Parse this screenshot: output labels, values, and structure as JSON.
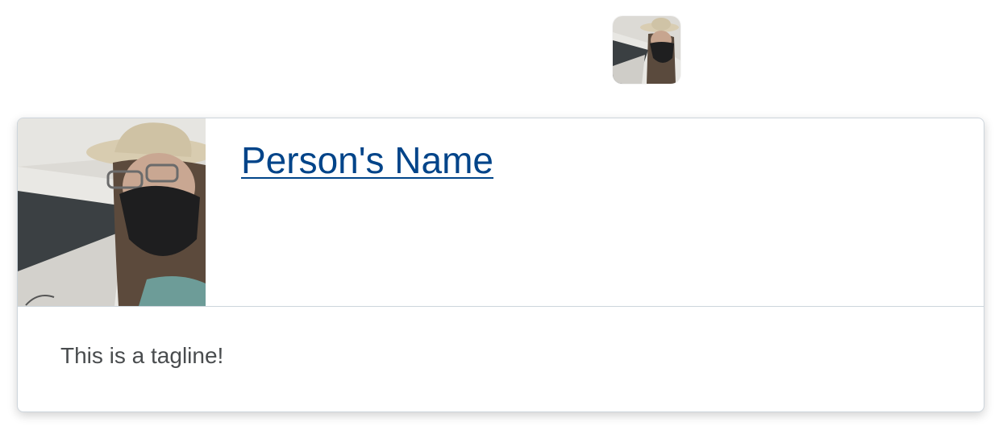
{
  "avatar": {
    "image": "profile-photo-masked-person-with-hat",
    "alt": "Profile photo"
  },
  "card": {
    "name": "Person's Name",
    "tagline": "This is a tagline!",
    "image": "profile-photo-masked-person-with-hat"
  },
  "colors": {
    "name_link": "#004489",
    "tagline": "#494c4e",
    "card_border": "#cdd5dc"
  }
}
